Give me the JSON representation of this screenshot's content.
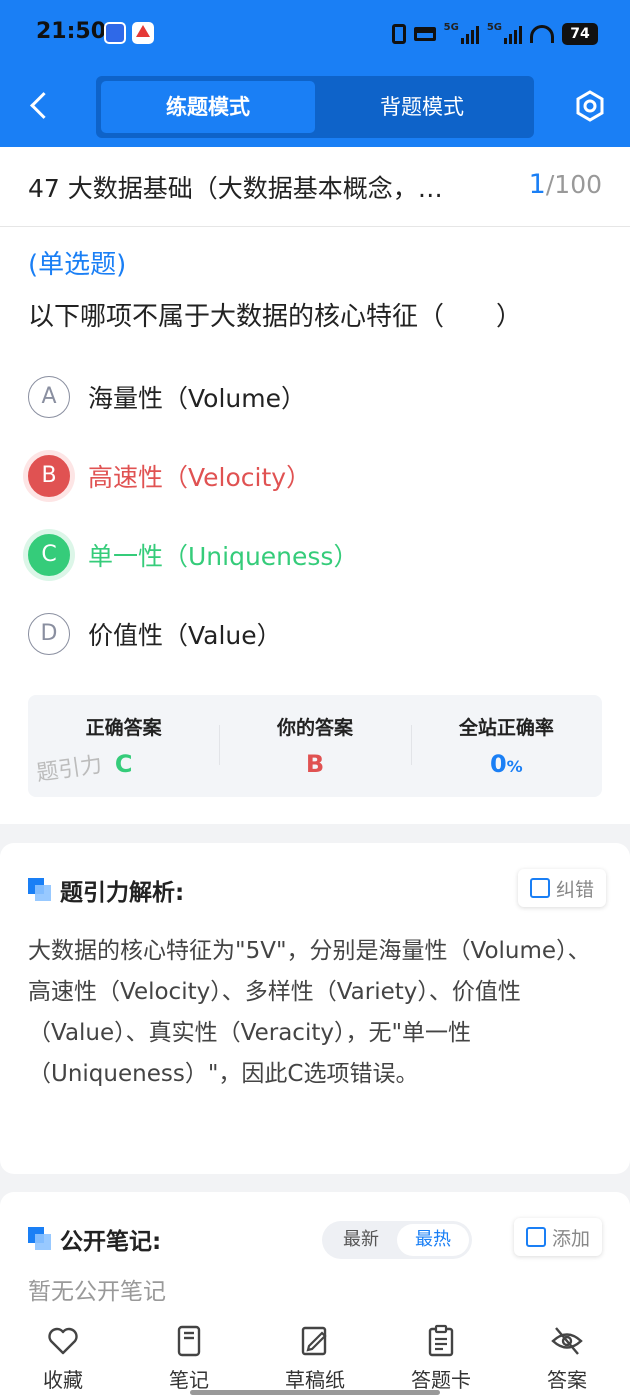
{
  "status_bar": {
    "time": "21:50",
    "battery": "74",
    "net1": "5G",
    "net2": "5G"
  },
  "header": {
    "tabs": [
      {
        "label": "练题模式",
        "active": true
      },
      {
        "label": "背题模式",
        "active": false
      }
    ]
  },
  "question_header": {
    "title": "47 大数据基础（大数据基本概念，…",
    "current": "1",
    "total": "/100"
  },
  "question": {
    "type": "(单选题)",
    "text": "以下哪项不属于大数据的核心特征（　　）",
    "options": [
      {
        "letter": "A",
        "text": "海量性（Volume）",
        "state": "normal"
      },
      {
        "letter": "B",
        "text": "高速性（Velocity）",
        "state": "wrong"
      },
      {
        "letter": "C",
        "text": "单一性（Uniqueness）",
        "state": "correct"
      },
      {
        "letter": "D",
        "text": "价值性（Value）",
        "state": "normal"
      }
    ]
  },
  "answers": {
    "correct_label": "正确答案",
    "correct_value": "C",
    "yours_label": "你的答案",
    "yours_value": "B",
    "rate_label": "全站正确率",
    "rate_value": "0",
    "rate_unit": "%",
    "watermark": "题引力"
  },
  "analysis": {
    "title": "题引力解析:",
    "report_label": "纠错",
    "text": "大数据的核心特征为\"5V\"，分别是海量性（Volume）、高速性（Velocity）、多样性（Variety）、价值性（Value）、真实性（Veracity），无\"单一性（Uniqueness）\"，因此C选项错误。"
  },
  "notes": {
    "title": "公开笔记:",
    "sort_options": [
      "最新",
      "最热"
    ],
    "add_label": "添加",
    "empty_text": "暂无公开笔记"
  },
  "bottom_nav": [
    {
      "label": "收藏",
      "icon": "heart-icon"
    },
    {
      "label": "笔记",
      "icon": "notebook-icon"
    },
    {
      "label": "草稿纸",
      "icon": "draft-icon"
    },
    {
      "label": "答题卡",
      "icon": "answer-sheet-icon"
    },
    {
      "label": "答案",
      "icon": "eye-off-icon"
    }
  ],
  "colors": {
    "primary": "#1a7ff5",
    "wrong": "#e05252",
    "correct": "#35cc7a"
  }
}
